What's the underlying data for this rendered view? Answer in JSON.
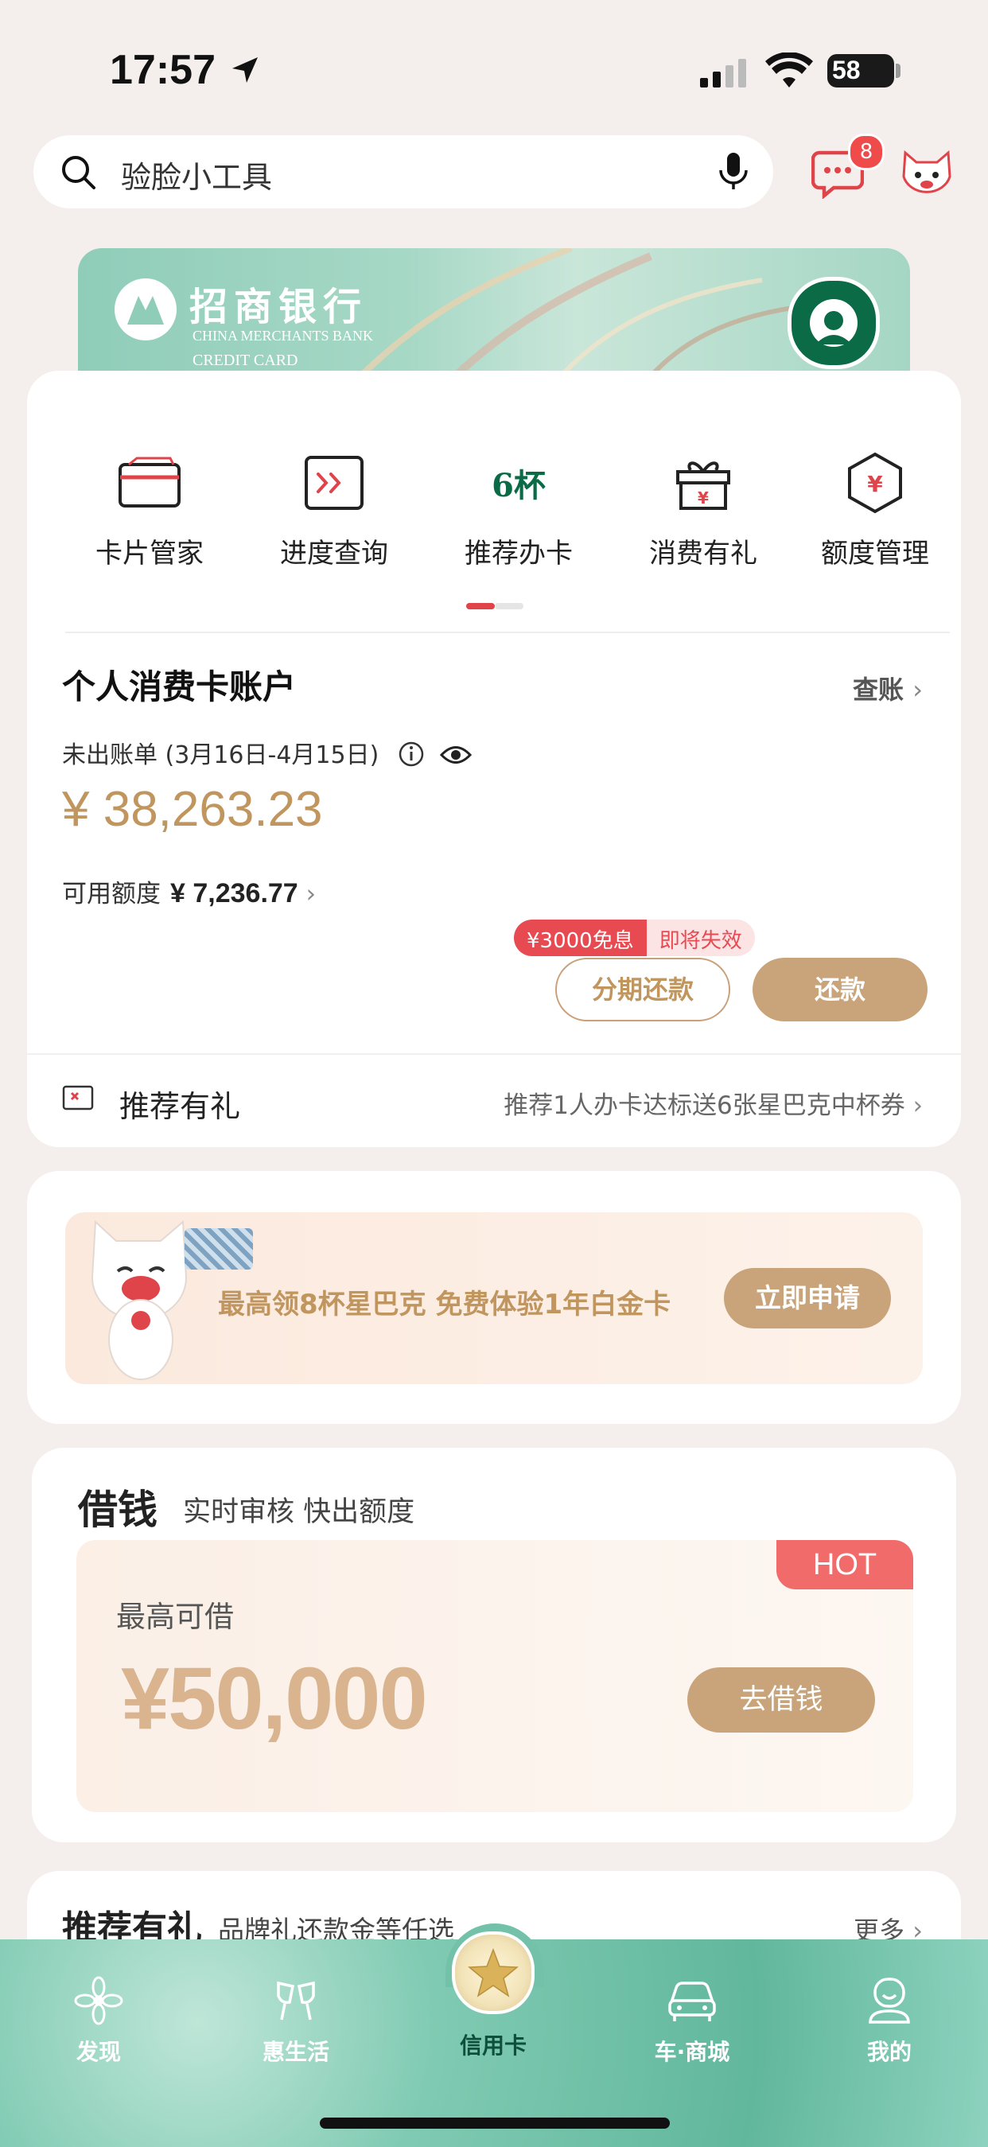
{
  "status": {
    "time": "17:57",
    "battery": "58"
  },
  "search": {
    "text": "验脸小工具",
    "message_badge": "8"
  },
  "banner": {
    "bank_name_cn": "招商银行",
    "bank_name_en": "CHINA MERCHANTS BANK",
    "card_type": "CREDIT CARD"
  },
  "quick_actions": [
    {
      "label": "卡片管家",
      "icon": "card-icon"
    },
    {
      "label": "进度查询",
      "icon": "progress-icon"
    },
    {
      "label": "推荐办卡",
      "icon": "six-cups-icon",
      "icon_text": "6杯"
    },
    {
      "label": "消费有礼",
      "icon": "gift-icon"
    },
    {
      "label": "额度管理",
      "icon": "yuan-hexagon-icon"
    }
  ],
  "account": {
    "title": "个人消费卡账户",
    "check_bill": "查账",
    "unbilled": "未出账单 (3月16日-4月15日)",
    "amount": "¥ 38,263.23",
    "available_label": "可用额度",
    "available_value": "¥ 7,236.77",
    "promo_tag_a": "¥3000免息",
    "promo_tag_b": "即将失效",
    "installment_btn": "分期还款",
    "repay_btn": "还款"
  },
  "referral": {
    "label": "推荐有礼",
    "desc": "推荐1人办卡达标送6张星巴克中杯券"
  },
  "promo": {
    "text": "最高领8杯星巴克 免费体验1年白金卡",
    "button": "立即申请"
  },
  "loan": {
    "title": "借钱",
    "subtitle": "实时审核 快出额度",
    "hot": "HOT",
    "max_label": "最高可借",
    "max_amount": "¥50,000",
    "button": "去借钱"
  },
  "recommend": {
    "title": "推荐有礼",
    "subtitle": "品牌礼还款金等任选",
    "more": "更多"
  },
  "tabs": [
    {
      "label": "发现",
      "icon": "discover-icon"
    },
    {
      "label": "惠生活",
      "icon": "cheers-icon"
    },
    {
      "label": "信用卡",
      "icon": "star-icon"
    },
    {
      "label": "车·商城",
      "icon": "car-icon"
    },
    {
      "label": "我的",
      "icon": "profile-icon"
    }
  ],
  "colors": {
    "accent_gold": "#c9a47a",
    "amount": "#c0955e",
    "badge_red": "#f04b4b",
    "teal": "#7fcab2"
  }
}
